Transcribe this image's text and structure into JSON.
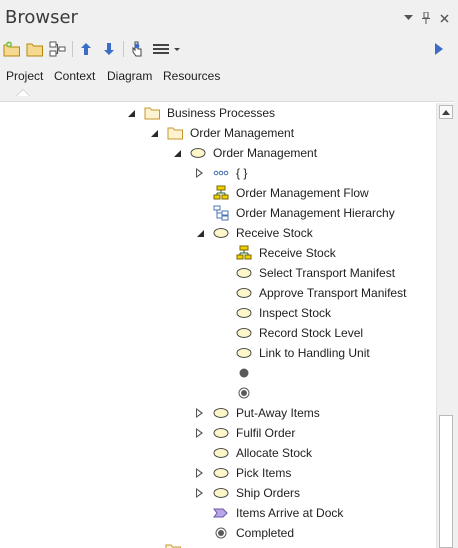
{
  "window": {
    "title": "Browser"
  },
  "tabs": [
    {
      "label": "Project"
    },
    {
      "label": "Context"
    },
    {
      "label": "Diagram"
    },
    {
      "label": "Resources"
    }
  ],
  "tree": [
    {
      "label": "Business Processes",
      "icon": "folder-icon",
      "expander": "open"
    },
    {
      "label": "Order Management",
      "icon": "folder-icon",
      "expander": "open"
    },
    {
      "label": "Order Management",
      "icon": "use-case-icon",
      "expander": "open"
    },
    {
      "label": "{ }",
      "icon": "ellipsis-icon",
      "expander": "closed"
    },
    {
      "label": "Order Management Flow",
      "icon": "activity-diagram-icon",
      "expander": "none"
    },
    {
      "label": "Order Management Hierarchy",
      "icon": "hierarchy-diagram-icon",
      "expander": "none"
    },
    {
      "label": "Receive Stock",
      "icon": "use-case-icon",
      "expander": "open"
    },
    {
      "label": "Receive Stock",
      "icon": "activity-diagram-icon",
      "expander": "none"
    },
    {
      "label": "Select Transport Manifest",
      "icon": "use-case-icon",
      "expander": "none"
    },
    {
      "label": "Approve Transport Manifest",
      "icon": "use-case-icon",
      "expander": "none"
    },
    {
      "label": "Inspect Stock",
      "icon": "use-case-icon",
      "expander": "none"
    },
    {
      "label": "Record Stock Level",
      "icon": "use-case-icon",
      "expander": "none"
    },
    {
      "label": "Link to Handling Unit",
      "icon": "use-case-icon",
      "expander": "none"
    },
    {
      "label": "",
      "icon": "initial-node-icon",
      "expander": "none"
    },
    {
      "label": "",
      "icon": "final-node-icon",
      "expander": "none"
    },
    {
      "label": "Put-Away Items",
      "icon": "use-case-icon",
      "expander": "closed"
    },
    {
      "label": "Fulfil Order",
      "icon": "use-case-icon",
      "expander": "closed"
    },
    {
      "label": "Allocate Stock",
      "icon": "use-case-icon",
      "expander": "none"
    },
    {
      "label": "Pick Items",
      "icon": "use-case-icon",
      "expander": "closed"
    },
    {
      "label": "Ship Orders",
      "icon": "use-case-icon",
      "expander": "closed"
    },
    {
      "label": "Items Arrive at Dock",
      "icon": "event-icon",
      "expander": "none"
    },
    {
      "label": "Completed",
      "icon": "final-node-icon",
      "expander": "none"
    }
  ]
}
